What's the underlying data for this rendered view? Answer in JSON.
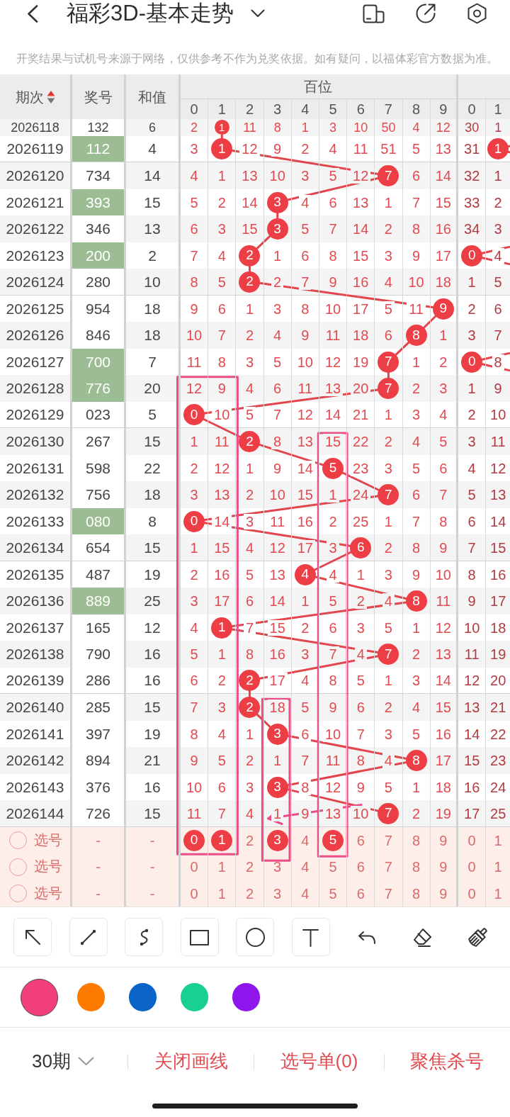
{
  "header": {
    "title": "福彩3D-基本走势"
  },
  "notice": "开奖结果与试机号来源于网络，仅供参考不作为兑奖依据。如有疑问，以福体彩官方数据为准。",
  "table": {
    "columns": [
      {
        "label": "期次",
        "sort_ascending": true
      },
      {
        "label": "奖号"
      },
      {
        "label": "和值"
      }
    ],
    "groups": [
      {
        "title": "百位",
        "digits": [
          "0",
          "1",
          "2",
          "3",
          "4",
          "5",
          "6",
          "7",
          "8",
          "9"
        ]
      },
      {
        "digits": [
          "0",
          "1"
        ]
      }
    ],
    "rows": [
      {
        "issue": "2026118",
        "number": "132",
        "sum": "6",
        "highlighted": false,
        "hundreds": [
          "2",
          "1",
          "11",
          "8",
          "1",
          "3",
          "10",
          "50",
          "4",
          "12"
        ],
        "hundreds_hit": [
          false,
          true,
          false,
          false,
          false,
          false,
          false,
          false,
          false,
          false
        ],
        "tens": [
          "30",
          "1"
        ],
        "tens_hit": [
          false,
          false
        ]
      },
      {
        "issue": "2026119",
        "number": "112",
        "sum": "4",
        "highlighted": true,
        "hundreds": [
          "3",
          "1",
          "12",
          "9",
          "2",
          "4",
          "11",
          "51",
          "5",
          "13"
        ],
        "hundreds_hit": [
          false,
          true,
          false,
          false,
          false,
          false,
          false,
          false,
          false,
          false
        ],
        "tens": [
          "31",
          "1"
        ],
        "tens_hit": [
          false,
          true
        ]
      },
      {
        "issue": "2026120",
        "number": "734",
        "sum": "14",
        "highlighted": false,
        "hundreds": [
          "4",
          "1",
          "13",
          "10",
          "3",
          "5",
          "12",
          "7",
          "6",
          "14"
        ],
        "hundreds_hit": [
          false,
          false,
          false,
          false,
          false,
          false,
          false,
          true,
          false,
          false
        ],
        "tens": [
          "32",
          "1"
        ],
        "tens_hit": [
          false,
          false
        ]
      },
      {
        "issue": "2026121",
        "number": "393",
        "sum": "15",
        "highlighted": true,
        "hundreds": [
          "5",
          "2",
          "14",
          "3",
          "4",
          "6",
          "13",
          "1",
          "7",
          "15"
        ],
        "hundreds_hit": [
          false,
          false,
          false,
          true,
          false,
          false,
          false,
          false,
          false,
          false
        ],
        "tens": [
          "33",
          "2"
        ],
        "tens_hit": [
          false,
          false
        ]
      },
      {
        "issue": "2026122",
        "number": "346",
        "sum": "13",
        "highlighted": false,
        "hundreds": [
          "6",
          "3",
          "15",
          "3",
          "5",
          "7",
          "14",
          "2",
          "8",
          "16"
        ],
        "hundreds_hit": [
          false,
          false,
          false,
          true,
          false,
          false,
          false,
          false,
          false,
          false
        ],
        "tens": [
          "34",
          "3"
        ],
        "tens_hit": [
          false,
          false
        ]
      },
      {
        "issue": "2026123",
        "number": "200",
        "sum": "2",
        "highlighted": true,
        "hundreds": [
          "7",
          "4",
          "2",
          "1",
          "6",
          "8",
          "15",
          "3",
          "9",
          "17"
        ],
        "hundreds_hit": [
          false,
          false,
          true,
          false,
          false,
          false,
          false,
          false,
          false,
          false
        ],
        "tens": [
          "0",
          "4"
        ],
        "tens_hit": [
          true,
          false
        ]
      },
      {
        "issue": "2026124",
        "number": "280",
        "sum": "10",
        "highlighted": false,
        "hundreds": [
          "8",
          "5",
          "2",
          "2",
          "7",
          "9",
          "16",
          "4",
          "10",
          "18"
        ],
        "hundreds_hit": [
          false,
          false,
          true,
          false,
          false,
          false,
          false,
          false,
          false,
          false
        ],
        "tens": [
          "1",
          "5"
        ],
        "tens_hit": [
          false,
          false
        ]
      },
      {
        "issue": "2026125",
        "number": "954",
        "sum": "18",
        "highlighted": false,
        "hundreds": [
          "9",
          "6",
          "1",
          "3",
          "8",
          "10",
          "17",
          "5",
          "11",
          "9"
        ],
        "hundreds_hit": [
          false,
          false,
          false,
          false,
          false,
          false,
          false,
          false,
          false,
          true
        ],
        "tens": [
          "2",
          "6"
        ],
        "tens_hit": [
          false,
          false
        ]
      },
      {
        "issue": "2026126",
        "number": "846",
        "sum": "18",
        "highlighted": false,
        "hundreds": [
          "10",
          "7",
          "2",
          "4",
          "9",
          "11",
          "18",
          "6",
          "8",
          "1"
        ],
        "hundreds_hit": [
          false,
          false,
          false,
          false,
          false,
          false,
          false,
          false,
          true,
          false
        ],
        "tens": [
          "3",
          "7"
        ],
        "tens_hit": [
          false,
          false
        ]
      },
      {
        "issue": "2026127",
        "number": "700",
        "sum": "7",
        "highlighted": true,
        "hundreds": [
          "11",
          "8",
          "3",
          "5",
          "10",
          "12",
          "19",
          "7",
          "1",
          "2"
        ],
        "hundreds_hit": [
          false,
          false,
          false,
          false,
          false,
          false,
          false,
          true,
          false,
          false
        ],
        "tens": [
          "0",
          "8"
        ],
        "tens_hit": [
          true,
          false
        ]
      },
      {
        "issue": "2026128",
        "number": "776",
        "sum": "20",
        "highlighted": true,
        "hundreds": [
          "12",
          "9",
          "4",
          "6",
          "11",
          "13",
          "20",
          "7",
          "2",
          "3"
        ],
        "hundreds_hit": [
          false,
          false,
          false,
          false,
          false,
          false,
          false,
          true,
          false,
          false
        ],
        "tens": [
          "1",
          "9"
        ],
        "tens_hit": [
          false,
          false
        ]
      },
      {
        "issue": "2026129",
        "number": "023",
        "sum": "5",
        "highlighted": false,
        "hundreds": [
          "0",
          "10",
          "5",
          "7",
          "12",
          "14",
          "21",
          "1",
          "3",
          "4"
        ],
        "hundreds_hit": [
          true,
          false,
          false,
          false,
          false,
          false,
          false,
          false,
          false,
          false
        ],
        "tens": [
          "2",
          "10"
        ],
        "tens_hit": [
          false,
          false
        ]
      },
      {
        "issue": "2026130",
        "number": "267",
        "sum": "15",
        "highlighted": false,
        "hundreds": [
          "1",
          "11",
          "2",
          "8",
          "13",
          "15",
          "22",
          "2",
          "4",
          "5"
        ],
        "hundreds_hit": [
          false,
          false,
          true,
          false,
          false,
          false,
          false,
          false,
          false,
          false
        ],
        "tens": [
          "3",
          "11"
        ],
        "tens_hit": [
          false,
          false
        ]
      },
      {
        "issue": "2026131",
        "number": "598",
        "sum": "22",
        "highlighted": false,
        "hundreds": [
          "2",
          "12",
          "1",
          "9",
          "14",
          "5",
          "23",
          "3",
          "5",
          "6"
        ],
        "hundreds_hit": [
          false,
          false,
          false,
          false,
          false,
          true,
          false,
          false,
          false,
          false
        ],
        "tens": [
          "4",
          "12"
        ],
        "tens_hit": [
          false,
          false
        ]
      },
      {
        "issue": "2026132",
        "number": "756",
        "sum": "18",
        "highlighted": false,
        "hundreds": [
          "3",
          "13",
          "2",
          "10",
          "15",
          "1",
          "24",
          "7",
          "6",
          "7"
        ],
        "hundreds_hit": [
          false,
          false,
          false,
          false,
          false,
          false,
          false,
          true,
          false,
          false
        ],
        "tens": [
          "5",
          "13"
        ],
        "tens_hit": [
          false,
          false
        ]
      },
      {
        "issue": "2026133",
        "number": "080",
        "sum": "8",
        "highlighted": true,
        "hundreds": [
          "0",
          "14",
          "3",
          "11",
          "16",
          "2",
          "25",
          "1",
          "7",
          "8"
        ],
        "hundreds_hit": [
          true,
          false,
          false,
          false,
          false,
          false,
          false,
          false,
          false,
          false
        ],
        "tens": [
          "6",
          "14"
        ],
        "tens_hit": [
          false,
          false
        ]
      },
      {
        "issue": "2026134",
        "number": "654",
        "sum": "15",
        "highlighted": false,
        "hundreds": [
          "1",
          "15",
          "4",
          "12",
          "17",
          "3",
          "6",
          "2",
          "8",
          "9"
        ],
        "hundreds_hit": [
          false,
          false,
          false,
          false,
          false,
          false,
          true,
          false,
          false,
          false
        ],
        "tens": [
          "7",
          "15"
        ],
        "tens_hit": [
          false,
          false
        ]
      },
      {
        "issue": "2026135",
        "number": "487",
        "sum": "19",
        "highlighted": false,
        "hundreds": [
          "2",
          "16",
          "5",
          "13",
          "4",
          "4",
          "1",
          "3",
          "9",
          "10"
        ],
        "hundreds_hit": [
          false,
          false,
          false,
          false,
          true,
          false,
          false,
          false,
          false,
          false
        ],
        "tens": [
          "8",
          "16"
        ],
        "tens_hit": [
          false,
          false
        ]
      },
      {
        "issue": "2026136",
        "number": "889",
        "sum": "25",
        "highlighted": true,
        "hundreds": [
          "3",
          "17",
          "6",
          "14",
          "1",
          "5",
          "2",
          "4",
          "8",
          "11"
        ],
        "hundreds_hit": [
          false,
          false,
          false,
          false,
          false,
          false,
          false,
          false,
          true,
          false
        ],
        "tens": [
          "9",
          "17"
        ],
        "tens_hit": [
          false,
          false
        ]
      },
      {
        "issue": "2026137",
        "number": "165",
        "sum": "12",
        "highlighted": false,
        "hundreds": [
          "4",
          "1",
          "7",
          "15",
          "2",
          "6",
          "3",
          "5",
          "1",
          "12"
        ],
        "hundreds_hit": [
          false,
          true,
          false,
          false,
          false,
          false,
          false,
          false,
          false,
          false
        ],
        "tens": [
          "10",
          "18"
        ],
        "tens_hit": [
          false,
          false
        ]
      },
      {
        "issue": "2026138",
        "number": "790",
        "sum": "16",
        "highlighted": false,
        "hundreds": [
          "5",
          "1",
          "8",
          "16",
          "3",
          "7",
          "4",
          "7",
          "2",
          "13"
        ],
        "hundreds_hit": [
          false,
          false,
          false,
          false,
          false,
          false,
          false,
          true,
          false,
          false
        ],
        "tens": [
          "11",
          "19"
        ],
        "tens_hit": [
          false,
          false
        ]
      },
      {
        "issue": "2026139",
        "number": "286",
        "sum": "16",
        "highlighted": false,
        "hundreds": [
          "6",
          "2",
          "2",
          "17",
          "4",
          "8",
          "5",
          "1",
          "3",
          "14"
        ],
        "hundreds_hit": [
          false,
          false,
          true,
          false,
          false,
          false,
          false,
          false,
          false,
          false
        ],
        "tens": [
          "12",
          "20"
        ],
        "tens_hit": [
          false,
          false
        ]
      },
      {
        "issue": "2026140",
        "number": "285",
        "sum": "15",
        "highlighted": false,
        "hundreds": [
          "7",
          "3",
          "2",
          "18",
          "5",
          "9",
          "6",
          "2",
          "4",
          "15"
        ],
        "hundreds_hit": [
          false,
          false,
          true,
          false,
          false,
          false,
          false,
          false,
          false,
          false
        ],
        "tens": [
          "13",
          "21"
        ],
        "tens_hit": [
          false,
          false
        ]
      },
      {
        "issue": "2026141",
        "number": "397",
        "sum": "19",
        "highlighted": false,
        "hundreds": [
          "8",
          "4",
          "1",
          "3",
          "6",
          "10",
          "7",
          "3",
          "5",
          "16"
        ],
        "hundreds_hit": [
          false,
          false,
          false,
          true,
          false,
          false,
          false,
          false,
          false,
          false
        ],
        "tens": [
          "14",
          "22"
        ],
        "tens_hit": [
          false,
          false
        ]
      },
      {
        "issue": "2026142",
        "number": "894",
        "sum": "21",
        "highlighted": false,
        "hundreds": [
          "9",
          "5",
          "2",
          "1",
          "7",
          "11",
          "8",
          "4",
          "8",
          "17"
        ],
        "hundreds_hit": [
          false,
          false,
          false,
          false,
          false,
          false,
          false,
          false,
          true,
          false
        ],
        "tens": [
          "15",
          "23"
        ],
        "tens_hit": [
          false,
          false
        ]
      },
      {
        "issue": "2026143",
        "number": "376",
        "sum": "16",
        "highlighted": false,
        "hundreds": [
          "10",
          "6",
          "3",
          "3",
          "8",
          "12",
          "9",
          "5",
          "1",
          "18"
        ],
        "hundreds_hit": [
          false,
          false,
          false,
          true,
          false,
          false,
          false,
          false,
          false,
          false
        ],
        "tens": [
          "16",
          "24"
        ],
        "tens_hit": [
          false,
          false
        ]
      },
      {
        "issue": "2026144",
        "number": "726",
        "sum": "15",
        "highlighted": false,
        "hundreds": [
          "11",
          "7",
          "4",
          "1",
          "9",
          "13",
          "10",
          "7",
          "2",
          "19"
        ],
        "hundreds_hit": [
          false,
          false,
          false,
          false,
          false,
          false,
          false,
          true,
          false,
          false
        ],
        "tens": [
          "17",
          "25"
        ],
        "tens_hit": [
          false,
          false
        ]
      }
    ],
    "pick_rows": [
      {
        "checked": false,
        "label": "选号",
        "number": "-",
        "sum": "-",
        "hundreds": [
          "0",
          "1",
          "2",
          "3",
          "4",
          "5",
          "6",
          "7",
          "8",
          "9"
        ],
        "hundreds_selected": [
          true,
          true,
          false,
          true,
          false,
          true,
          false,
          false,
          false,
          false
        ],
        "tens": [
          "0",
          "1"
        ],
        "tens_selected": [
          false,
          false
        ]
      },
      {
        "checked": false,
        "label": "选号",
        "number": "-",
        "sum": "-",
        "hundreds": [
          "0",
          "1",
          "2",
          "3",
          "4",
          "5",
          "6",
          "7",
          "8",
          "9"
        ],
        "hundreds_selected": [
          false,
          false,
          false,
          false,
          false,
          false,
          false,
          false,
          false,
          false
        ],
        "tens": [
          "0",
          "1"
        ],
        "tens_selected": [
          false,
          false
        ]
      },
      {
        "checked": false,
        "label": "选号",
        "number": "-",
        "sum": "-",
        "hundreds": [
          "0",
          "1",
          "2",
          "3",
          "4",
          "5",
          "6",
          "7",
          "8",
          "9"
        ],
        "hundreds_selected": [
          false,
          false,
          false,
          false,
          false,
          false,
          false,
          false,
          false,
          false
        ],
        "tens": [
          "0",
          "1"
        ],
        "tens_selected": [
          false,
          false
        ]
      }
    ]
  },
  "drawings": [
    {
      "kind": "rect"
    },
    {
      "kind": "rect"
    },
    {
      "kind": "rect"
    },
    {
      "kind": "arrow"
    }
  ],
  "pen_colors": [
    {
      "color": "#f13f7b",
      "selected": true
    },
    {
      "color": "#ff7b00",
      "selected": false
    },
    {
      "color": "#0b64c8",
      "selected": false
    },
    {
      "color": "#18d190",
      "selected": false
    },
    {
      "color": "#8e16ec",
      "selected": false
    }
  ],
  "bottom_bar": {
    "period": "30期",
    "actions": [
      "关闭画线",
      "选号单(0)",
      "聚焦杀号"
    ]
  }
}
